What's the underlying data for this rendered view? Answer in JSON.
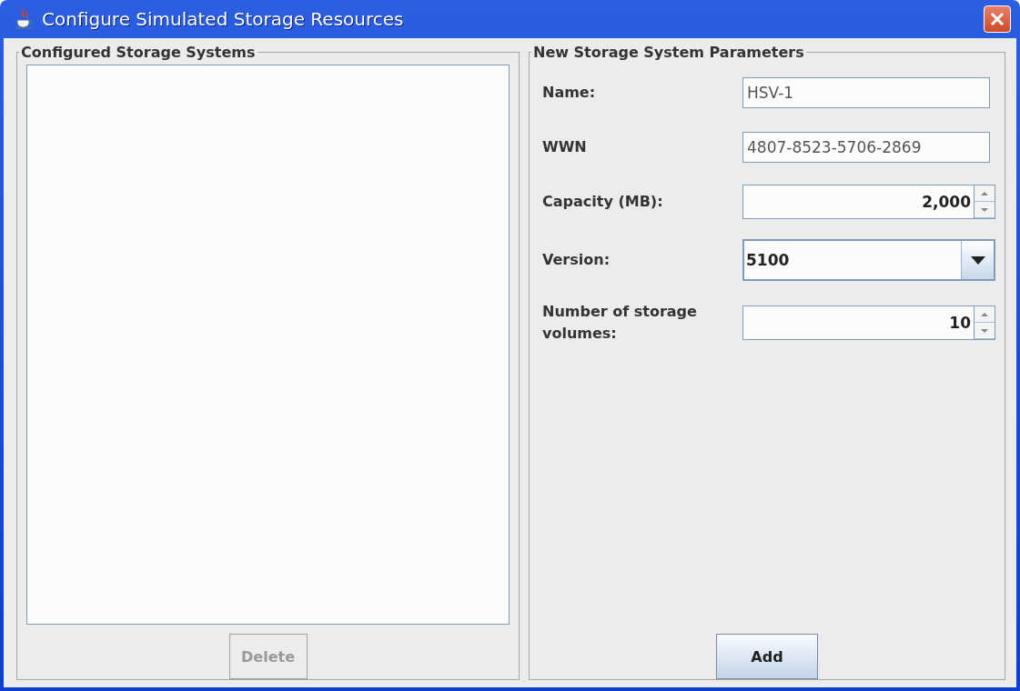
{
  "window": {
    "title": "Configure Simulated Storage Resources"
  },
  "left_panel": {
    "legend": "Configured Storage Systems",
    "delete_button": {
      "label": "Delete",
      "disabled": true
    }
  },
  "right_panel": {
    "legend": "New Storage System Parameters",
    "fields": [
      {
        "kind": "text",
        "label": "Name:",
        "value": "HSV-1"
      },
      {
        "kind": "text",
        "label": "WWN",
        "value": "4807-8523-5706-2869"
      },
      {
        "kind": "spinner",
        "label": "Capacity (MB):",
        "value": "2,000"
      },
      {
        "kind": "combo",
        "label": "Version:",
        "value": "5100"
      },
      {
        "kind": "spinner",
        "label": "Number of storage volumes:",
        "value": "10"
      }
    ],
    "add_button": {
      "label": "Add",
      "disabled": false
    }
  }
}
